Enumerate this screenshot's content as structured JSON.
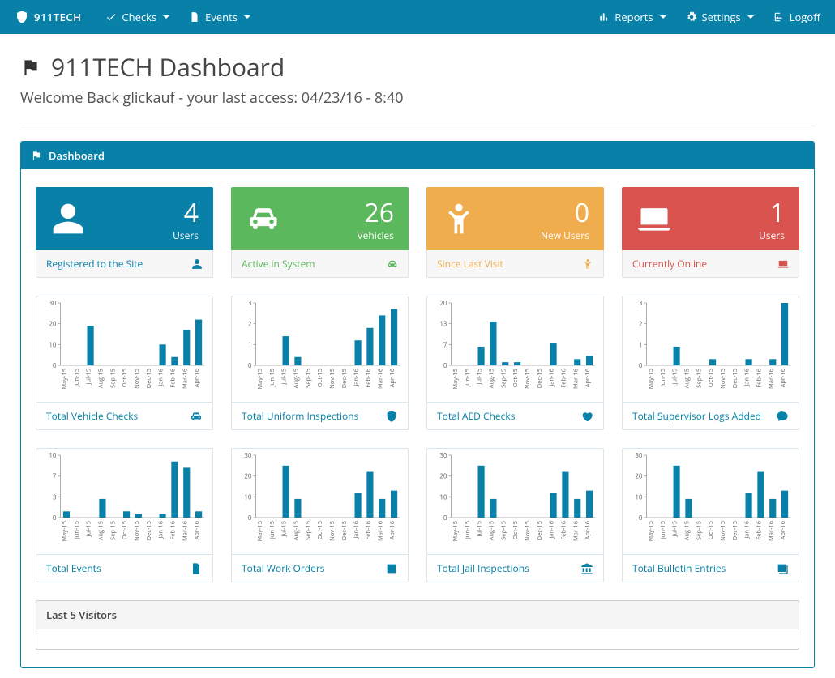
{
  "brand": "911TECH",
  "nav": {
    "checks": "Checks",
    "events": "Events",
    "reports": "Reports",
    "settings": "Settings",
    "logoff": "Logoff"
  },
  "header": {
    "title": "911TECH Dashboard",
    "welcome": "Welcome Back glickauf - your last access: 04/23/16 - 8:40"
  },
  "panel_title": "Dashboard",
  "stats": {
    "users": {
      "value": "4",
      "unit": "Users",
      "caption": "Registered to the Site"
    },
    "vehicles": {
      "value": "26",
      "unit": "Vehicles",
      "caption": "Active in System"
    },
    "newusers": {
      "value": "0",
      "unit": "New Users",
      "caption": "Since Last Visit"
    },
    "online": {
      "value": "1",
      "unit": "Users",
      "caption": "Currently Online"
    }
  },
  "visitors_title": "Last 5 Visitors",
  "chart_data": [
    {
      "id": "vehicle_checks",
      "title": "Total Vehicle Checks",
      "type": "bar",
      "ylim": [
        0,
        30
      ],
      "categories": [
        "May-15",
        "Jun-15",
        "Jul-15",
        "Aug-15",
        "Sep-15",
        "Oct-15",
        "Nov-15",
        "Dec-15",
        "Jan-16",
        "Feb-16",
        "Mar-16",
        "Apr-16"
      ],
      "values": [
        0,
        0,
        19,
        0,
        0,
        0,
        0,
        0,
        10,
        4,
        17,
        22
      ]
    },
    {
      "id": "uniform",
      "title": "Total Uniform Inspections",
      "type": "bar",
      "ylim": [
        0,
        3
      ],
      "categories": [
        "May-15",
        "Jun-15",
        "Jul-15",
        "Aug-15",
        "Sep-15",
        "Oct-15",
        "Nov-15",
        "Dec-15",
        "Jan-16",
        "Feb-16",
        "Mar-16",
        "Apr-16"
      ],
      "values": [
        0,
        0,
        1.4,
        0.4,
        0,
        0,
        0,
        0,
        1.2,
        1.8,
        2.4,
        2.7
      ]
    },
    {
      "id": "aed",
      "title": "Total AED Checks",
      "type": "bar",
      "ylim": [
        0,
        20
      ],
      "categories": [
        "May-15",
        "Jun-15",
        "Jul-15",
        "Aug-15",
        "Sep-15",
        "Oct-15",
        "Nov-15",
        "Dec-15",
        "Jan-16",
        "Feb-16",
        "Mar-16",
        "Apr-16"
      ],
      "values": [
        0,
        0,
        6,
        14,
        1,
        1,
        0,
        0,
        7,
        0,
        2,
        3
      ]
    },
    {
      "id": "supervisor",
      "title": "Total Supervisor Logs Added",
      "type": "bar",
      "ylim": [
        0,
        3
      ],
      "categories": [
        "May-15",
        "Jun-15",
        "Jul-15",
        "Aug-15",
        "Sep-15",
        "Oct-15",
        "Nov-15",
        "Dec-15",
        "Jan-16",
        "Feb-16",
        "Mar-16",
        "Apr-16"
      ],
      "values": [
        0,
        0,
        0.9,
        0,
        0,
        0.3,
        0,
        0,
        0.3,
        0,
        0.3,
        3
      ]
    },
    {
      "id": "events",
      "title": "Total Events",
      "type": "bar",
      "ylim": [
        0,
        10
      ],
      "categories": [
        "May-15",
        "Jun-15",
        "Jul-15",
        "Aug-15",
        "Sep-15",
        "Oct-15",
        "Nov-15",
        "Dec-15",
        "Jan-16",
        "Feb-16",
        "Mar-16",
        "Apr-16"
      ],
      "values": [
        1,
        0,
        0,
        3,
        0,
        1,
        0.6,
        0,
        0.6,
        9,
        8,
        1
      ]
    },
    {
      "id": "workorders",
      "title": "Total Work Orders",
      "type": "bar",
      "ylim": [
        0,
        30
      ],
      "categories": [
        "May-15",
        "Jun-15",
        "Jul-15",
        "Aug-15",
        "Sep-15",
        "Oct-15",
        "Nov-15",
        "Dec-15",
        "Jan-16",
        "Feb-16",
        "Mar-16",
        "Apr-16"
      ],
      "values": [
        0,
        0,
        25,
        9,
        0,
        0,
        0,
        0,
        12,
        22,
        9,
        13
      ]
    },
    {
      "id": "jail",
      "title": "Total Jail Inspections",
      "type": "bar",
      "ylim": [
        0,
        30
      ],
      "categories": [
        "May-15",
        "Jun-15",
        "Jul-15",
        "Aug-15",
        "Sep-15",
        "Oct-15",
        "Nov-15",
        "Dec-15",
        "Jan-16",
        "Feb-16",
        "Mar-16",
        "Apr-16"
      ],
      "values": [
        0,
        0,
        25,
        9,
        0,
        0,
        0,
        0,
        12,
        22,
        9,
        13
      ]
    },
    {
      "id": "bulletin",
      "title": "Total Bulletin Entries",
      "type": "bar",
      "ylim": [
        0,
        30
      ],
      "categories": [
        "May-15",
        "Jun-15",
        "Jul-15",
        "Aug-15",
        "Sep-15",
        "Oct-15",
        "Nov-15",
        "Dec-15",
        "Jan-16",
        "Feb-16",
        "Mar-16",
        "Apr-16"
      ],
      "values": [
        0,
        0,
        25,
        9,
        0,
        0,
        0,
        0,
        12,
        22,
        9,
        13
      ]
    }
  ]
}
